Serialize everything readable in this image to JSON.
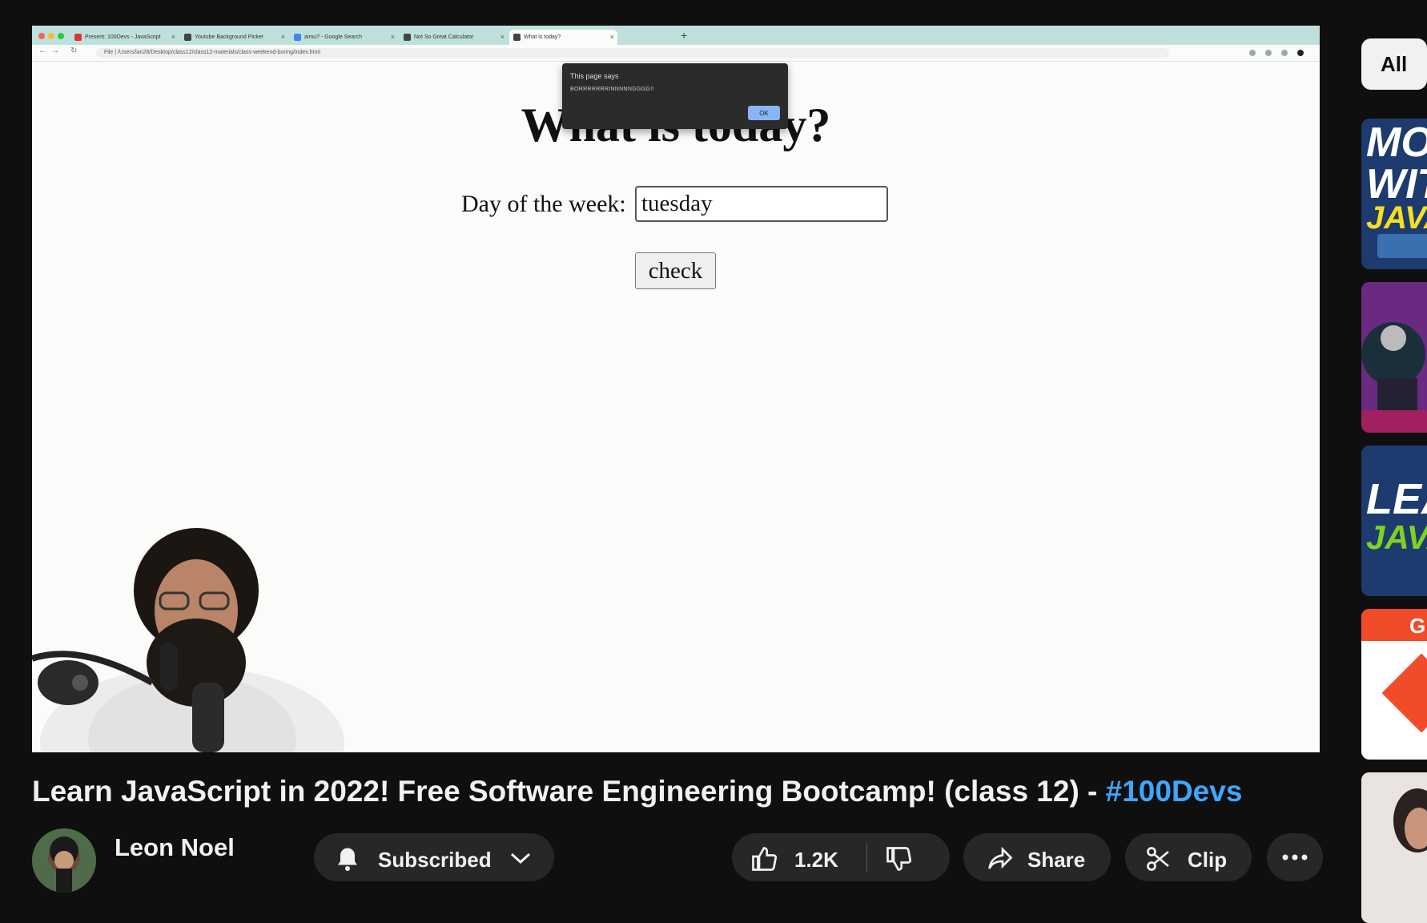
{
  "browser": {
    "tabs": [
      {
        "label": "Present: 100Devs - JavaScript",
        "favicon_color": "#d33"
      },
      {
        "label": "Youtube Background Picker",
        "favicon_color": "#444"
      },
      {
        "label": "aimu? - Google Search",
        "favicon_color": "#4285f4"
      },
      {
        "label": "Not So Great Calculator",
        "favicon_color": "#444"
      },
      {
        "label": "What is today?",
        "favicon_color": "#444"
      }
    ],
    "address": "File | /Users/lan28/Desktop/class12/class12-materials/class-weekend-boring/index.html"
  },
  "page": {
    "heading": "What is today?",
    "day_label": "Day of the week:",
    "day_value": "tuesday",
    "check_label": "check"
  },
  "alert": {
    "title": "This page says",
    "message": "BORRRRRRRINNNNNGGGG!!",
    "ok_label": "OK"
  },
  "video": {
    "title": "Learn JavaScript in 2022! Free Software Engineering Bootcamp! (class 12) - ",
    "hashtag": "#100Devs"
  },
  "channel": {
    "name": "Leon Noel",
    "subscribe_label": "Subscribed"
  },
  "actions": {
    "likes": "1.2K",
    "share_label": "Share",
    "clip_label": "Clip",
    "more_icon": "more-icon"
  },
  "sidebar": {
    "chip_all": "All",
    "thumbs": [
      {
        "text": "MO WIT JAVA FREE",
        "bg": "#1d3b6e"
      },
      {
        "text": "",
        "bg": "#6b2a82"
      },
      {
        "text": "LEA JAVA FREE",
        "bg": "#1d3b6e"
      },
      {
        "text": "G",
        "bg": "#f24b2a"
      },
      {
        "text": "",
        "bg": "#e9e4e0"
      }
    ]
  },
  "colors": {
    "accent": "#3ea6ff",
    "background": "#0f0f0f"
  }
}
